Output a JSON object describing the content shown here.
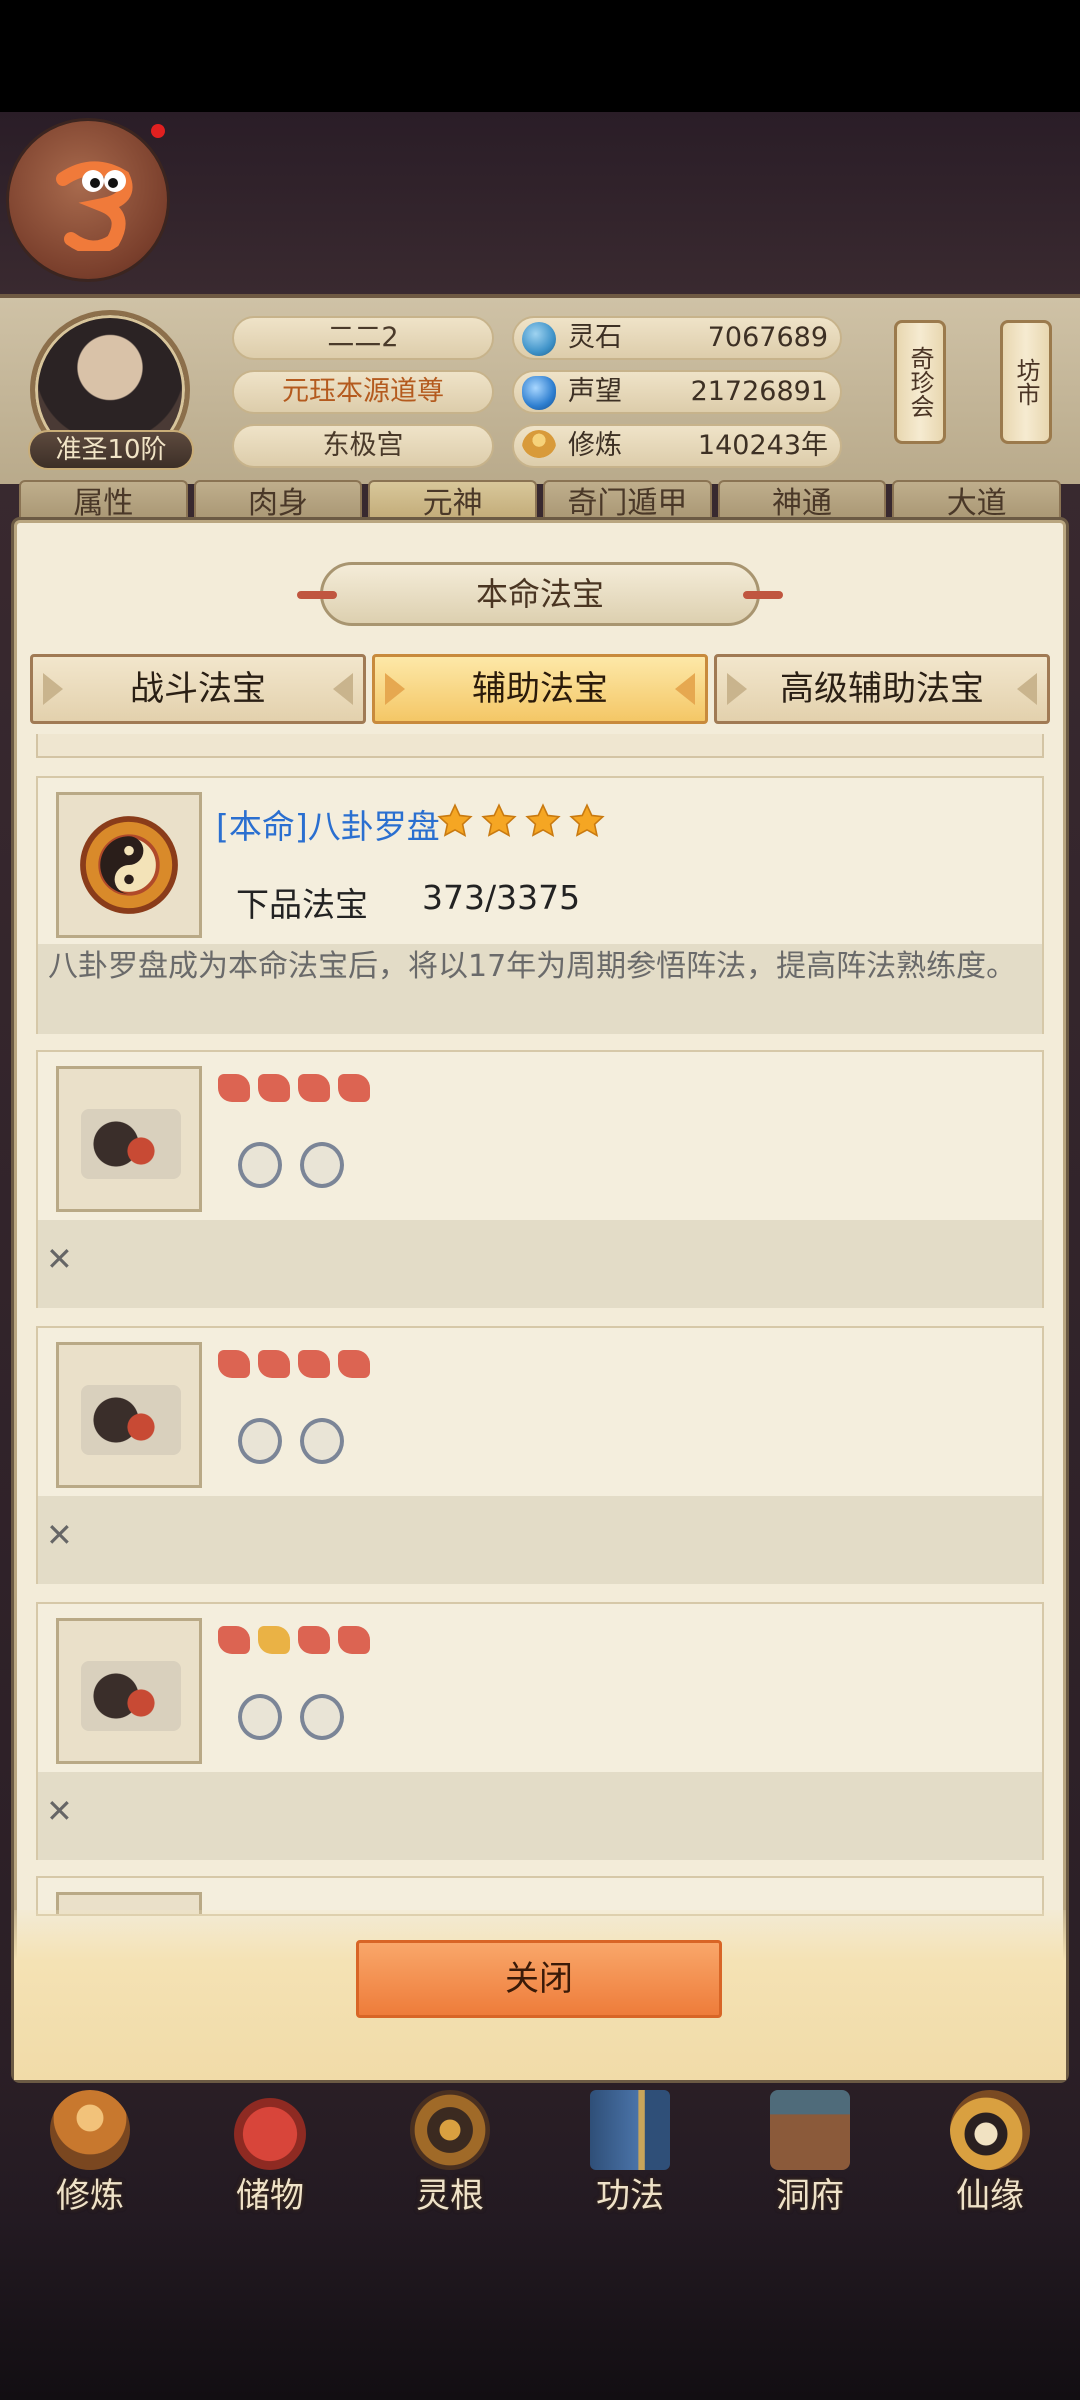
{
  "player": {
    "name": "二二2",
    "title": "元珏本源道尊",
    "location": "东极宫",
    "rank": "准圣10阶"
  },
  "resources": [
    {
      "label": "灵石",
      "value": "7067689",
      "icon": "spirit-stone-icon",
      "color": "#3f93c9"
    },
    {
      "label": "声望",
      "value": "21726891",
      "icon": "reputation-icon",
      "color": "#2f7fd0"
    },
    {
      "label": "修炼",
      "value": "140243年",
      "icon": "meditation-icon",
      "color": "#d89a3a"
    }
  ],
  "side_buttons": [
    "奇珍会",
    "坊市"
  ],
  "main_tabs": [
    "属性",
    "肉身",
    "元神",
    "奇门遁甲",
    "神通",
    "大道"
  ],
  "modal": {
    "title": "本命法宝",
    "sub_tabs": [
      {
        "label": "战斗法宝",
        "active": false
      },
      {
        "label": "辅助法宝",
        "active": true
      },
      {
        "label": "高级辅助法宝",
        "active": false
      }
    ],
    "featured": {
      "name": "[本命]八卦罗盘",
      "stars": 4,
      "grade": "下品法宝",
      "progress": "373/3375",
      "description": "八卦罗盘成为本命法宝后，将以17年为周期参悟阵法，提高阵法熟练度。"
    },
    "close_label": "关闭"
  },
  "bottom_nav": [
    {
      "label": "修炼",
      "icon": "meditation-nav-icon"
    },
    {
      "label": "储物",
      "icon": "storage-bag-icon"
    },
    {
      "label": "灵根",
      "icon": "spirit-root-icon"
    },
    {
      "label": "功法",
      "icon": "technique-book-icon"
    },
    {
      "label": "洞府",
      "icon": "cave-dwelling-icon"
    },
    {
      "label": "仙缘",
      "icon": "immortal-fate-icon"
    }
  ],
  "colors": {
    "accent": "#f4c766",
    "featured_name": "#2a6fd0",
    "close_button": "#ee7c3a"
  }
}
